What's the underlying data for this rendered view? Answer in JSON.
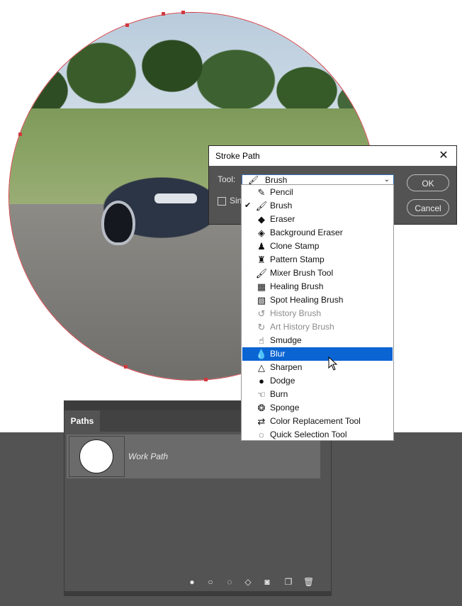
{
  "dialog": {
    "title": "Stroke Path",
    "close_icon": "close-icon",
    "tool_label": "Tool:",
    "tool_value": "Brush",
    "simulate_pressure_label": "Sin",
    "ok_label": "OK",
    "cancel_label": "Cancel"
  },
  "dropdown": {
    "items": [
      {
        "label": "Pencil",
        "icon": "pencil-icon",
        "glyph": "✎",
        "checked": false,
        "disabled": false,
        "selected": false
      },
      {
        "label": "Brush",
        "icon": "brush-icon",
        "glyph": "🖌",
        "checked": true,
        "disabled": false,
        "selected": false
      },
      {
        "label": "Eraser",
        "icon": "eraser-icon",
        "glyph": "◆",
        "checked": false,
        "disabled": false,
        "selected": false
      },
      {
        "label": "Background Eraser",
        "icon": "background-eraser-icon",
        "glyph": "◈",
        "checked": false,
        "disabled": false,
        "selected": false
      },
      {
        "label": "Clone Stamp",
        "icon": "clone-stamp-icon",
        "glyph": "♟",
        "checked": false,
        "disabled": false,
        "selected": false
      },
      {
        "label": "Pattern Stamp",
        "icon": "pattern-stamp-icon",
        "glyph": "♜",
        "checked": false,
        "disabled": false,
        "selected": false
      },
      {
        "label": "Mixer Brush Tool",
        "icon": "mixer-brush-icon",
        "glyph": "🖌",
        "checked": false,
        "disabled": false,
        "selected": false
      },
      {
        "label": "Healing Brush",
        "icon": "healing-brush-icon",
        "glyph": "▦",
        "checked": false,
        "disabled": false,
        "selected": false
      },
      {
        "label": "Spot Healing Brush",
        "icon": "spot-healing-brush-icon",
        "glyph": "▧",
        "checked": false,
        "disabled": false,
        "selected": false
      },
      {
        "label": "History Brush",
        "icon": "history-brush-icon",
        "glyph": "↺",
        "checked": false,
        "disabled": true,
        "selected": false
      },
      {
        "label": "Art History Brush",
        "icon": "art-history-brush-icon",
        "glyph": "↻",
        "checked": false,
        "disabled": true,
        "selected": false
      },
      {
        "label": "Smudge",
        "icon": "smudge-icon",
        "glyph": "☝",
        "checked": false,
        "disabled": false,
        "selected": false
      },
      {
        "label": "Blur",
        "icon": "blur-icon",
        "glyph": "💧",
        "checked": false,
        "disabled": false,
        "selected": true
      },
      {
        "label": "Sharpen",
        "icon": "sharpen-icon",
        "glyph": "△",
        "checked": false,
        "disabled": false,
        "selected": false
      },
      {
        "label": "Dodge",
        "icon": "dodge-icon",
        "glyph": "●",
        "checked": false,
        "disabled": false,
        "selected": false
      },
      {
        "label": "Burn",
        "icon": "burn-icon",
        "glyph": "☜",
        "checked": false,
        "disabled": false,
        "selected": false
      },
      {
        "label": "Sponge",
        "icon": "sponge-icon",
        "glyph": "❂",
        "checked": false,
        "disabled": false,
        "selected": false
      },
      {
        "label": "Color Replacement Tool",
        "icon": "color-replacement-icon",
        "glyph": "⇄",
        "checked": false,
        "disabled": false,
        "selected": false
      },
      {
        "label": "Quick Selection Tool",
        "icon": "quick-selection-icon",
        "glyph": "◌",
        "checked": false,
        "disabled": false,
        "selected": false
      }
    ]
  },
  "paths_panel": {
    "tab_label": "Paths",
    "path_name": "Work Path",
    "footer_icons": [
      "fill-path-icon",
      "stroke-path-icon",
      "load-selection-icon",
      "make-work-path-icon",
      "add-mask-icon",
      "new-path-icon",
      "delete-path-icon"
    ]
  },
  "colors": {
    "selection_blue": "#0a64d2",
    "path_red": "#d0393f",
    "panel_gray": "#535353"
  }
}
